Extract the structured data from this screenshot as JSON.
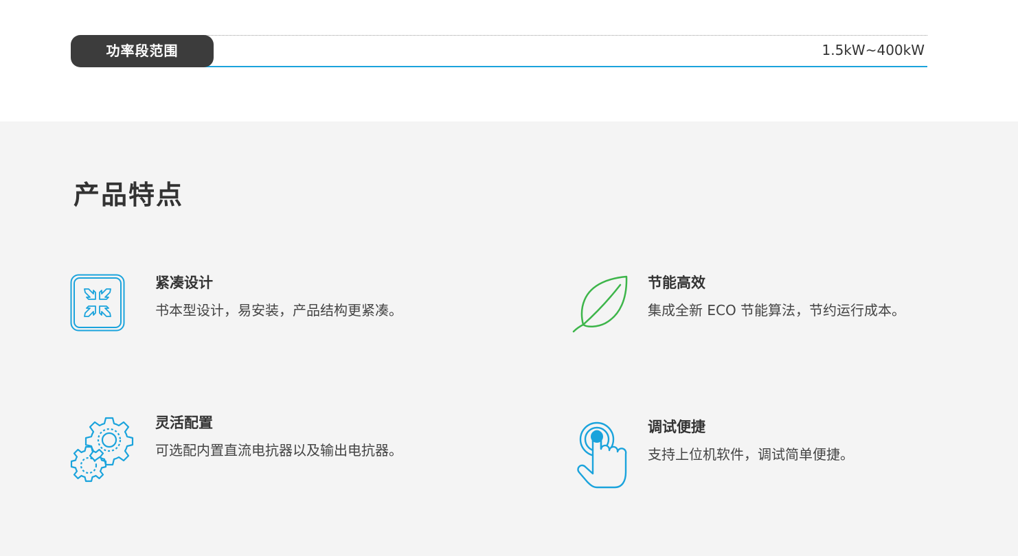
{
  "spec": {
    "label": "功率段范围",
    "value": "1.5kW~400kW"
  },
  "features_section": {
    "title": "产品特点",
    "items": [
      {
        "icon": "compact-arrows-icon",
        "title": "紧凑设计",
        "description": "书本型设计，易安装，产品结构更紧凑。",
        "icon_color": "#1aa3dc"
      },
      {
        "icon": "leaf-icon",
        "title": "节能高效",
        "description": "集成全新 ECO 节能算法，节约运行成本。",
        "icon_color": "#3db54a"
      },
      {
        "icon": "gears-icon",
        "title": "灵活配置",
        "description": "可选配内置直流电抗器以及输出电抗器。",
        "icon_color": "#1aa3dc"
      },
      {
        "icon": "touch-hand-icon",
        "title": "调试便捷",
        "description": "支持上位机软件，调试简单便捷。",
        "icon_color": "#1aa3dc"
      }
    ]
  },
  "colors": {
    "accent_blue": "#1aa3dc",
    "accent_green": "#3db54a",
    "label_bg": "#3c3c3c",
    "section_bg": "#f4f4f4",
    "text": "#333333"
  }
}
